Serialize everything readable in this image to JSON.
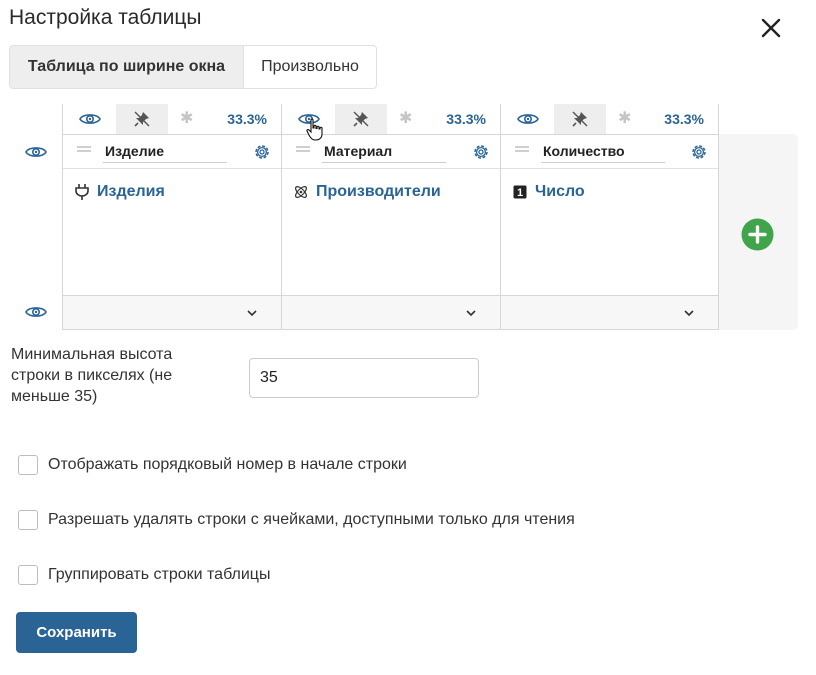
{
  "dialog": {
    "title": "Настройка таблицы"
  },
  "mode": {
    "active_label": "Таблица по ширине окна",
    "inactive_label": "Произвольно"
  },
  "columns": [
    {
      "width_label": "33.3%",
      "name": "Изделие",
      "field_label": "Изделия",
      "field_icon": "plug-icon"
    },
    {
      "width_label": "33.3%",
      "name": "Материал",
      "field_label": "Производители",
      "field_icon": "atom-icon"
    },
    {
      "width_label": "33.3%",
      "name": "Количество",
      "field_label": "Число",
      "field_icon": "number-icon",
      "field_badge": "1"
    }
  ],
  "min_height": {
    "label": "Минимальная высота строки в пикселях (не меньше 35)",
    "value": "35"
  },
  "options": [
    {
      "label": "Отображать порядковый номер в начале строки",
      "checked": false
    },
    {
      "label": "Разрешать удалять строки с ячейками, доступными только для чтения",
      "checked": false
    },
    {
      "label": "Группировать строки таблицы",
      "checked": false
    }
  ],
  "actions": {
    "save_label": "Сохранить"
  },
  "colors": {
    "accent": "#2a6496",
    "add": "#3fa44a"
  }
}
